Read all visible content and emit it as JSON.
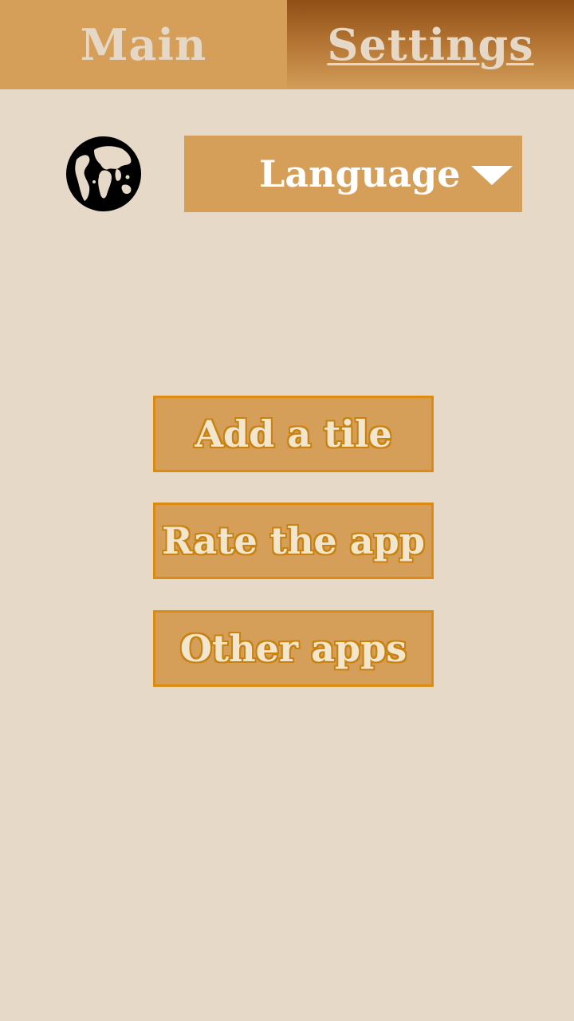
{
  "tabs": {
    "main_label": "Main",
    "settings_label": "Settings",
    "active": "Settings"
  },
  "language": {
    "icon": "globe-icon",
    "label": "Language",
    "arrow_icon": "dropdown-arrow-icon"
  },
  "actions": {
    "add_tile": "Add a tile",
    "rate_app": "Rate the app",
    "other_apps": "Other apps"
  },
  "colors": {
    "background": "#e6d9c8",
    "accent": "#d59f5a",
    "active_tab_top": "#8f4f16",
    "button_border": "#dc8a10",
    "tab_text": "#e6d8c6"
  }
}
